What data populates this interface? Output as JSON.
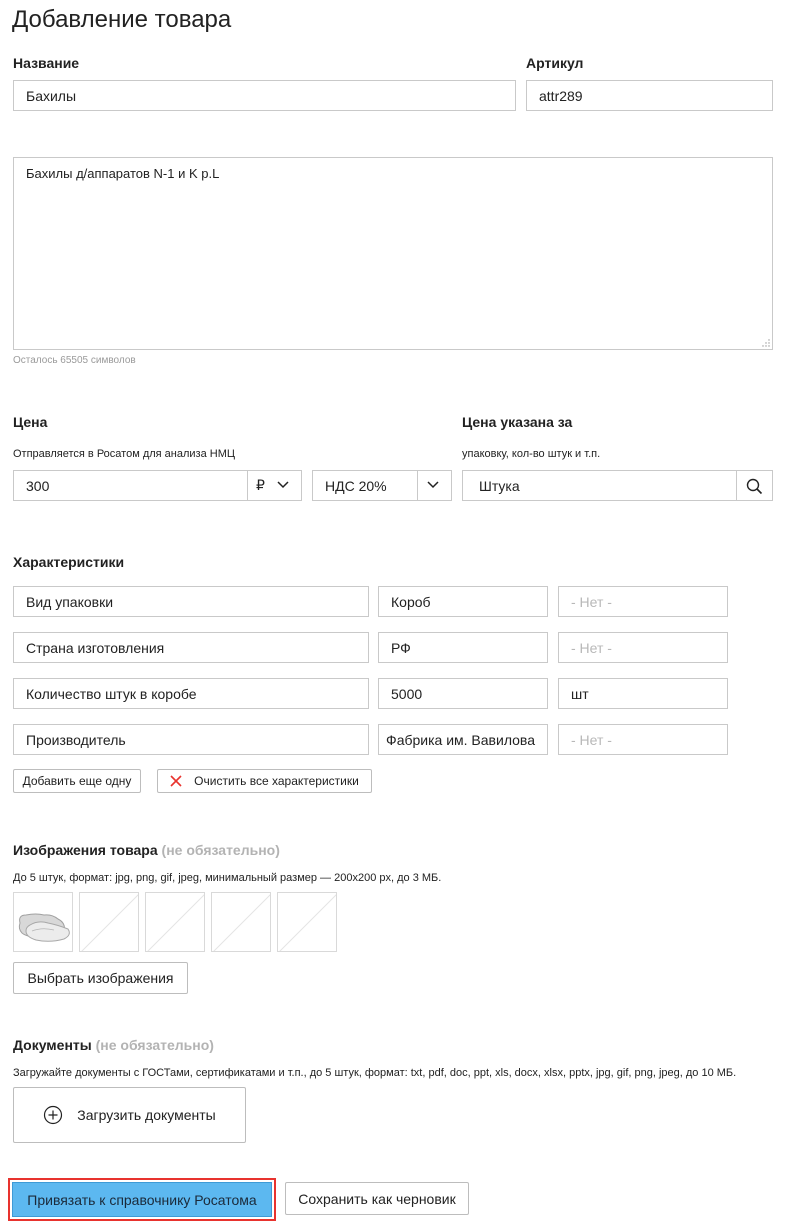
{
  "page": {
    "title": "Добавление товара"
  },
  "name_field": {
    "label": "Название",
    "value": "Бахилы"
  },
  "sku_field": {
    "label": "Артикул",
    "value": "attr289"
  },
  "description": {
    "value": "Бахилы д/аппаратов N-1 и K p.L",
    "counter": "Осталось 65505 символов"
  },
  "price": {
    "label": "Цена",
    "hint": "Отправляется в Росатом для анализа НМЦ",
    "value": "300",
    "currency": "₽",
    "vat": "НДС 20%"
  },
  "price_unit": {
    "label": "Цена указана за",
    "hint": "упаковку, кол-во штук и т.п.",
    "value": "Штука"
  },
  "characteristics": {
    "label": "Характеристики",
    "rows": [
      {
        "name": "Вид упаковки",
        "value": "Короб",
        "unit": "- Нет -",
        "unit_is_placeholder": true
      },
      {
        "name": "Страна изготовления",
        "value": "РФ",
        "unit": "- Нет -",
        "unit_is_placeholder": true
      },
      {
        "name": "Количество штук в коробе",
        "value": "5000",
        "unit": "шт",
        "unit_is_placeholder": false
      },
      {
        "name": "Производитель",
        "value": "Фабрика им. Вавилова",
        "unit": "- Нет -",
        "unit_is_placeholder": true
      }
    ],
    "add_label": "Добавить еще одну",
    "clear_label": "Очистить все характеристики"
  },
  "images": {
    "label": "Изображения товара",
    "optional": "(не обязательно)",
    "hint": "До 5 штук, формат: jpg, png, gif, jpeg, минимальный размер — 200x200 px, до 3 МБ.",
    "choose_label": "Выбрать изображения",
    "slots_filled": 1,
    "slots_total": 5
  },
  "documents": {
    "label": "Документы",
    "optional": "(не обязательно)",
    "hint": "Загружайте документы с ГОСТами, сертификатами и т.п., до 5 штук, формат: txt, pdf, doc, ppt, xls, docx, xlsx, pptx, jpg, gif, png, jpeg, до 10 МБ.",
    "upload_label": "Загрузить документы"
  },
  "footer": {
    "primary_label": "Привязать к справочнику Росатома",
    "draft_label": "Сохранить как черновик"
  },
  "colors": {
    "primary_bg": "#5cb8f0",
    "highlight_border": "#e8332e",
    "clear_icon": "#e8332e"
  }
}
